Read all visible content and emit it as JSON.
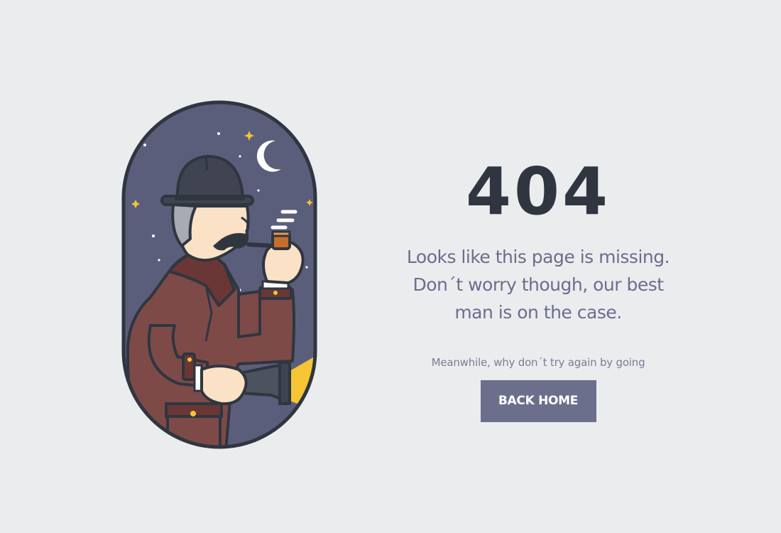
{
  "error": {
    "code": "404",
    "message_lines": [
      "Looks like this page is missing.",
      "Don´t worry though, our best",
      "man is on the case."
    ],
    "hint": "Meanwhile, why don´t try again by going",
    "button_label": "BACK HOME"
  },
  "illustration": {
    "subject": "detective-with-pipe-and-flashlight",
    "icons": [
      "moon-icon",
      "star-icon",
      "bowler-hat",
      "smoking-pipe",
      "flashlight"
    ]
  },
  "colors": {
    "background": "#ebecee",
    "sky": "#5b5e7b",
    "outline": "#2f3640",
    "coat": "#7d4a48",
    "heading": "#2f3640",
    "text": "#6a6e8c",
    "button": "#6c6f8b",
    "accent": "#f5c533"
  }
}
